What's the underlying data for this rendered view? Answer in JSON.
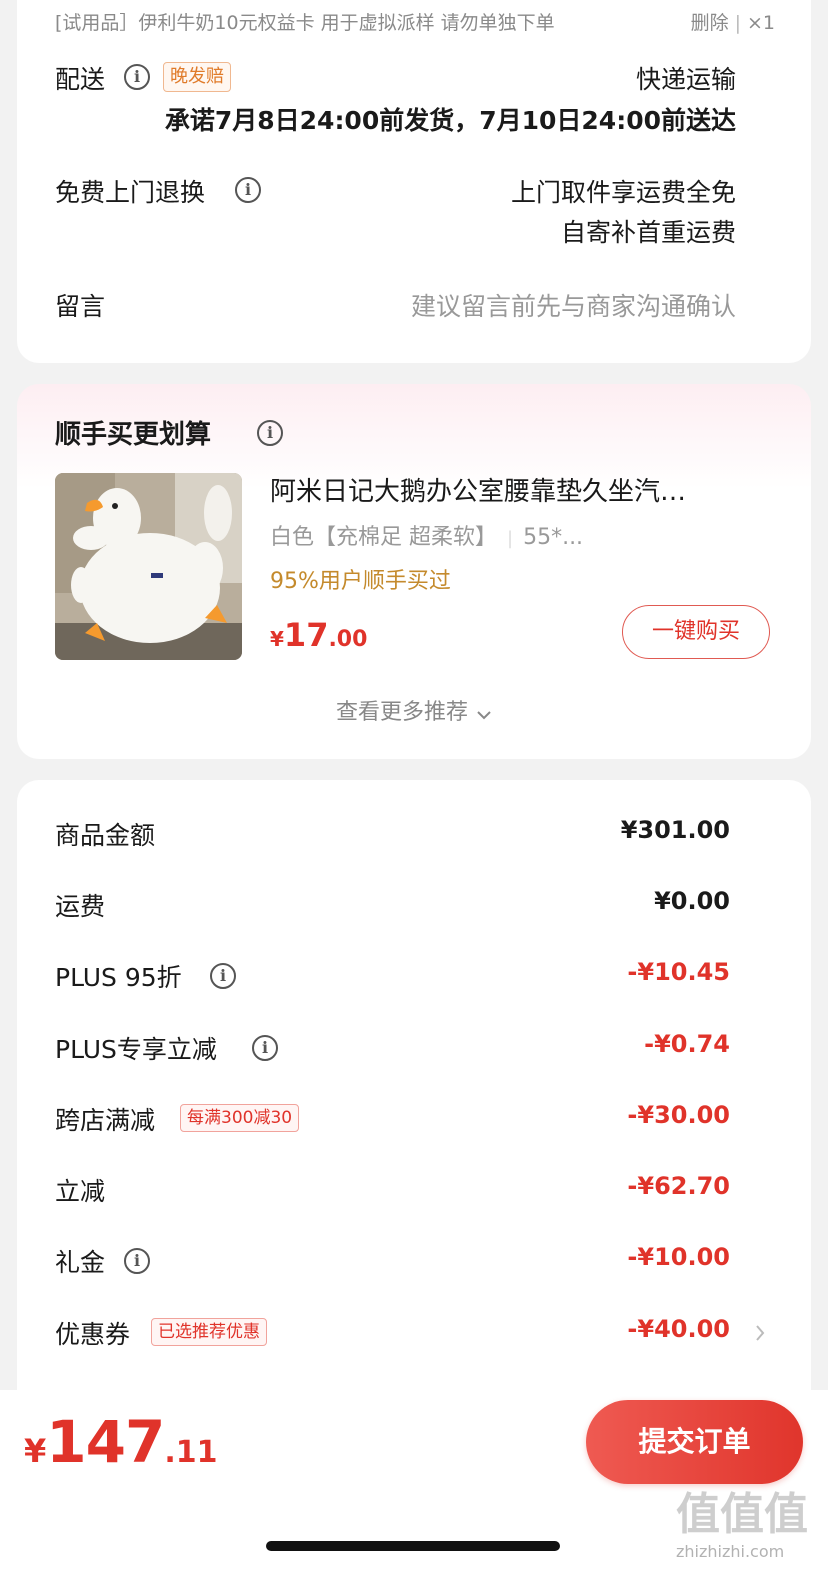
{
  "delivery": {
    "trial_item": "[试用品］伊利牛奶10元权益卡 用于虚拟派样 请勿单独下单",
    "delete_label": "删除",
    "quantity": "×1",
    "shipping_label": "配送",
    "late_tag": "晚发赔",
    "shipping_method": "快递运输",
    "shipping_promise": "承诺7月8日24:00前发货，7月10日24:00前送达",
    "return_label": "免费上门退换",
    "return_line1": "上门取件享运费全免",
    "return_line2": "自寄补首重运费",
    "message_label": "留言",
    "message_placeholder": "建议留言前先与商家沟通确认"
  },
  "recommend": {
    "title": "顺手买更划算",
    "product_name": "阿米日记大鹅办公室腰靠垫久坐汽…",
    "spec_color": "白色【充棉足 超柔软】",
    "spec_size": "55*...",
    "hint": "95%用户顺手买过",
    "price_currency": "¥",
    "price_int": "17",
    "price_dec": ".00",
    "buy_button": "一键购买",
    "more_link": "查看更多推荐"
  },
  "fees": {
    "rows": [
      {
        "label": "商品金额",
        "value": "¥301.00"
      },
      {
        "label": "运费",
        "value": "¥0.00"
      },
      {
        "label": "PLUS 95折",
        "value": "-¥10.45"
      },
      {
        "label": "PLUS专享立减",
        "value": "-¥0.74"
      },
      {
        "label": "跨店满减",
        "value": "-¥30.00",
        "tag": "每满300减30"
      },
      {
        "label": "立减",
        "value": "-¥62.70"
      },
      {
        "label": "礼金",
        "value": "-¥10.00"
      },
      {
        "label": "优惠券",
        "value": "-¥40.00",
        "tag": "已选推荐优惠"
      }
    ]
  },
  "footer": {
    "total_currency": "¥",
    "total_int": "147",
    "total_dec": ".11",
    "submit_button": "提交订单",
    "watermark_glyphs": "值值值",
    "watermark_url": "zhizhizhi.com"
  },
  "colors": {
    "accent_red": "#e0332a",
    "hint_gold": "#c48a2c",
    "late_tag_orange": "#e07b2a"
  }
}
